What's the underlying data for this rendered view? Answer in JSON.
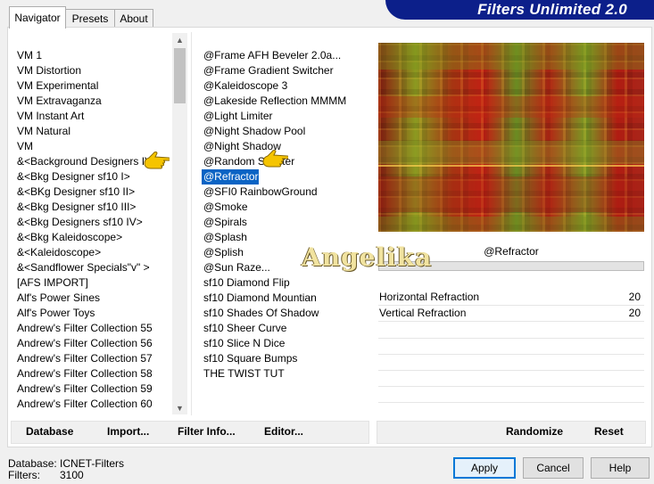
{
  "app": {
    "title": "Filters Unlimited 2.0"
  },
  "tabs": [
    {
      "label": "Navigator",
      "active": true
    },
    {
      "label": "Presets",
      "active": false
    },
    {
      "label": "About",
      "active": false
    }
  ],
  "categories": {
    "items": [
      "VM 1",
      "VM Distortion",
      "VM Experimental",
      "VM Extravaganza",
      "VM Instant Art",
      "VM Natural",
      "VM",
      "&<Background Designers IV>",
      "&<Bkg Designer sf10 I>",
      "&<BKg Designer sf10 II>",
      "&<Bkg Designer sf10 III>",
      "&<Bkg Designers sf10 IV>",
      "&<Bkg Kaleidoscope>",
      "&<Kaleidoscope>",
      "&<Sandflower Specials\"v\" >",
      "[AFS IMPORT]",
      "Alf's Power Sines",
      "Alf's Power Toys",
      "Andrew's Filter Collection 55",
      "Andrew's Filter Collection 56",
      "Andrew's Filter Collection 57",
      "Andrew's Filter Collection 58",
      "Andrew's Filter Collection 59",
      "Andrew's Filter Collection 60"
    ],
    "pointed_index": 7
  },
  "filters": {
    "items": [
      "@Frame AFH Beveler 2.0a...",
      "@Frame Gradient Switcher",
      "@Kaleidoscope 3",
      "@Lakeside Reflection MMMM",
      "@Light Limiter",
      "@Night Shadow Pool",
      "@Night Shadow",
      "@Random Smelter",
      "@Refractor",
      "@SFI0 RainbowGround",
      "@Smoke",
      "@Spirals",
      "@Splash",
      "@Splish",
      "@Sun Raze...",
      "sf10 Diamond Flip",
      "sf10 Diamond Mountian",
      "sf10 Shades Of Shadow",
      "sf10 Sheer Curve",
      "sf10 Slice N Dice",
      "sf10 Square Bumps",
      "THE TWIST TUT"
    ],
    "selected_index": 8
  },
  "effect": {
    "name": "@Refractor",
    "params": [
      {
        "label": "Horizontal Refraction",
        "value": "20"
      },
      {
        "label": "Vertical Refraction",
        "value": "20"
      }
    ]
  },
  "watermark": "Angelika",
  "actions": {
    "database": "Database",
    "import": "Import...",
    "filter_info": "Filter Info...",
    "editor": "Editor...",
    "randomize": "Randomize",
    "reset": "Reset"
  },
  "footer": {
    "database_label": "Database:",
    "database_value": "ICNET-Filters",
    "filters_label": "Filters:",
    "filters_value": "3100"
  },
  "buttons": {
    "apply": "Apply",
    "cancel": "Cancel",
    "help": "Help"
  },
  "colors": {
    "banner": "#0c1f8a",
    "selection": "#0a63c4",
    "pointer_hand": "#f5c400"
  }
}
